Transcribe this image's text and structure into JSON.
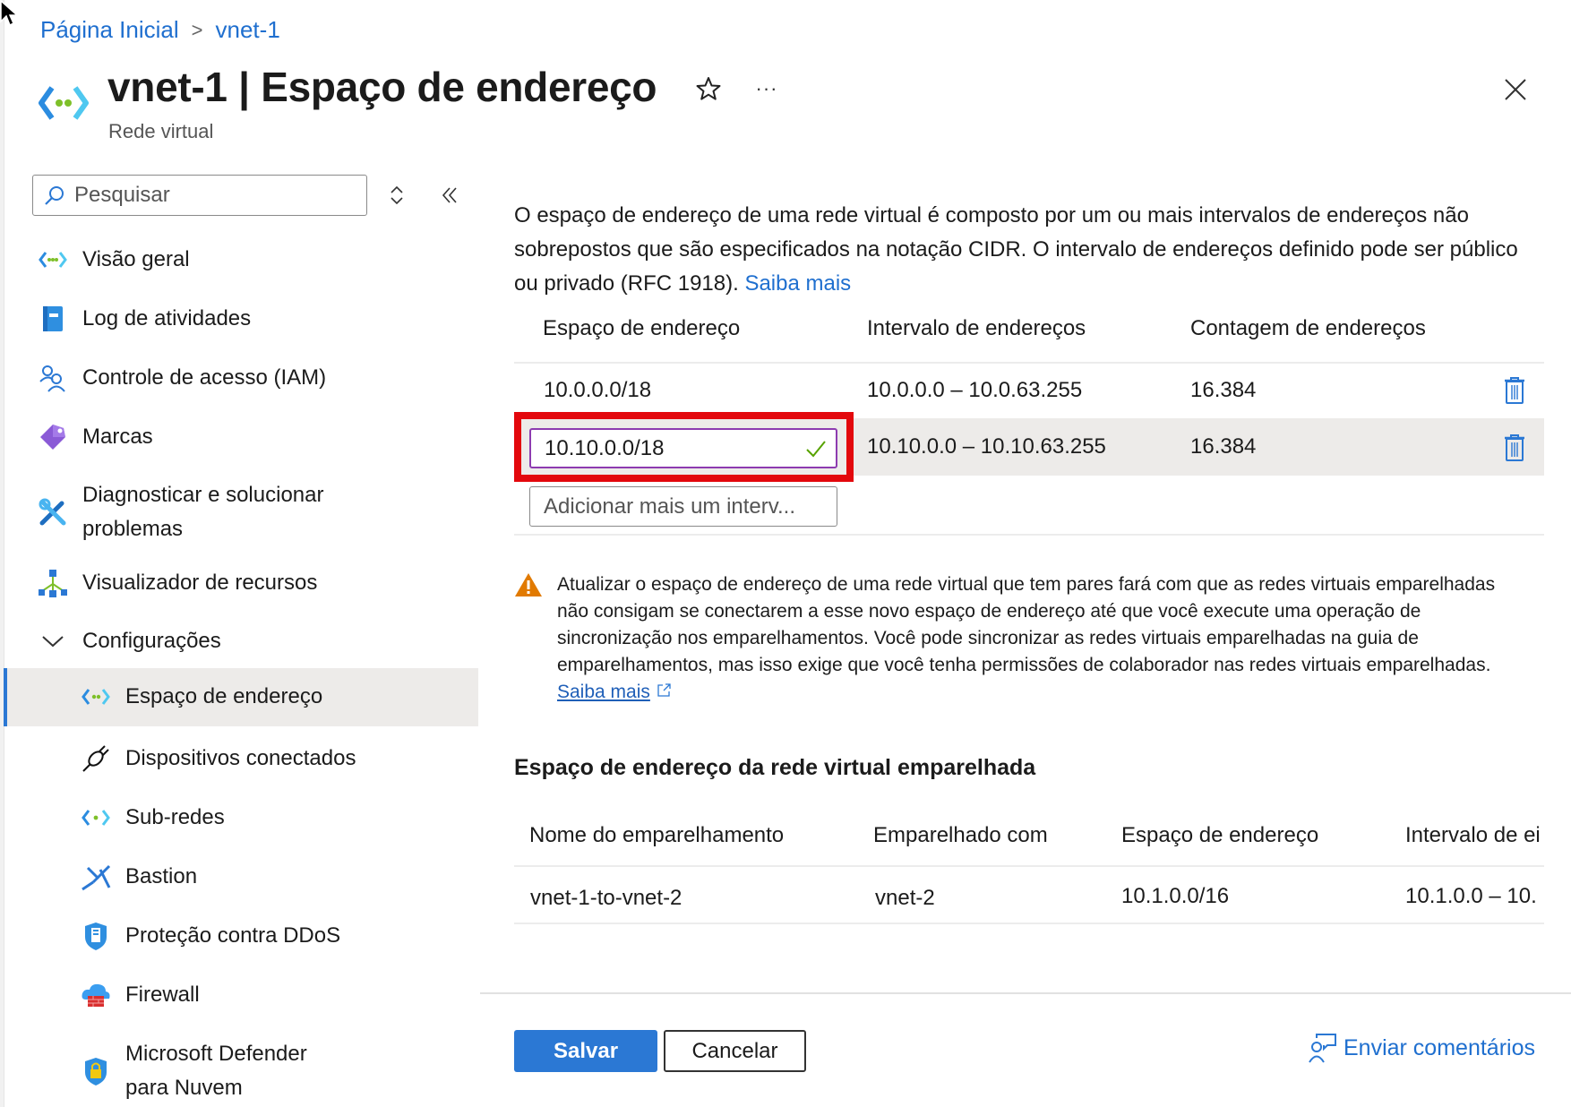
{
  "breadcrumb": {
    "items": [
      "Página Inicial",
      "vnet-1"
    ],
    "separator": ">"
  },
  "header": {
    "title": "vnet-1 | Espaço de endereço",
    "subtitle": "Rede virtual",
    "more_label": "···"
  },
  "sidebar": {
    "search_placeholder": "Pesquisar",
    "items": [
      {
        "label": "Visão geral",
        "icon": "vnet-icon"
      },
      {
        "label": "Log de atividades",
        "icon": "activity-log-icon"
      },
      {
        "label": "Controle de acesso (IAM)",
        "icon": "iam-icon"
      },
      {
        "label": "Marcas",
        "icon": "tag-icon"
      },
      {
        "label": "Diagnosticar e solucionar",
        "label2": "problemas",
        "icon": "wrench-icon"
      },
      {
        "label": "Visualizador de recursos",
        "icon": "resource-visualizer-icon"
      },
      {
        "label": "Configurações",
        "icon": "chevron-down-icon"
      },
      {
        "label": "Espaço de endereço",
        "icon": "vnet-icon",
        "selected": true
      },
      {
        "label": "Dispositivos conectados",
        "icon": "plug-icon"
      },
      {
        "label": "Sub-redes",
        "icon": "subnet-icon"
      },
      {
        "label": "Bastion",
        "icon": "bastion-icon"
      },
      {
        "label": "Proteção contra DDoS",
        "icon": "ddos-shield-icon"
      },
      {
        "label": "Firewall",
        "icon": "firewall-icon"
      },
      {
        "label": "Microsoft Defender",
        "label2": "para Nuvem",
        "icon": "defender-icon"
      }
    ]
  },
  "main": {
    "intro": "O espaço de endereço de uma rede virtual é composto por um ou mais intervalos de endereços não sobrepostos que são especificados na notação CIDR. O intervalo de endereços definido pode ser público ou privado (RFC 1918).",
    "intro_link": "Saiba mais",
    "address_table": {
      "headers": [
        "Espaço de endereço",
        "Intervalo de endereços",
        "Contagem de endereços"
      ],
      "rows": [
        {
          "space": "10.0.0.0/18",
          "range": "10.0.0.0 – 10.0.63.255",
          "count": "16.384"
        },
        {
          "space": "10.10.0.0/18",
          "range": "10.10.0.0 – 10.10.63.255",
          "count": "16.384",
          "editing": true
        }
      ],
      "add_placeholder": "Adicionar mais um interv..."
    },
    "warning": {
      "text": "Atualizar o espaço de endereço de uma rede virtual que tem pares fará com que as redes virtuais emparelhadas não consigam se conectarem a esse novo espaço de endereço até que você execute uma operação de sincronização nos emparelhamentos. Você pode sincronizar as redes virtuais emparelhadas na guia de emparelhamentos, mas isso exige que você tenha permissões de colaborador nas redes virtuais emparelhadas.",
      "link": "Saiba mais"
    },
    "peering_section": {
      "title": "Espaço de endereço da rede virtual emparelhada",
      "headers": [
        "Nome do emparelhamento",
        "Emparelhado com",
        "Espaço de endereço",
        "Intervalo de ei"
      ],
      "rows": [
        {
          "name": "vnet-1-to-vnet-2",
          "peer": "vnet-2",
          "space": "10.1.0.0/16",
          "range": "10.1.0.0 – 10."
        }
      ]
    }
  },
  "footer": {
    "save_label": "Salvar",
    "cancel_label": "Cancelar",
    "feedback_label": "Enviar comentários"
  },
  "colors": {
    "accent": "#2b78d4",
    "link": "#1f6fcf",
    "highlight_box": "#e3080d",
    "input_focus_border": "#8d3bb0",
    "valid_check": "#57a300",
    "warning": "#e17a00",
    "selected_bg": "#edebe9"
  }
}
